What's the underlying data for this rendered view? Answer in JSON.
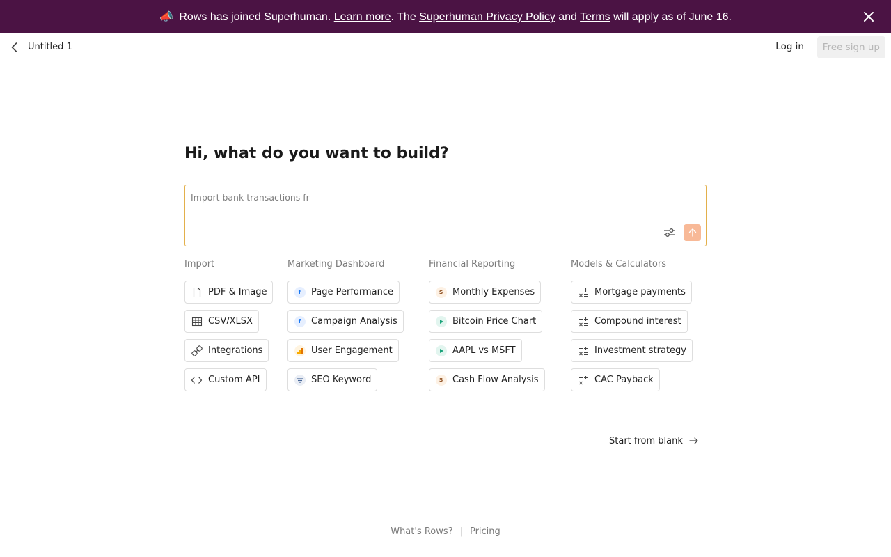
{
  "banner": {
    "megaphone": "📣",
    "text_1": " Rows has joined Superhuman. ",
    "learn_more": "Learn more",
    "text_2": ". The ",
    "privacy_policy": "Superhuman Privacy Policy",
    "text_3": " and ",
    "terms": "Terms",
    "text_4": " will apply as of June 16.",
    "close_icon": "close-icon",
    "background": "#4b1344"
  },
  "topbar": {
    "back_icon": "chevron-left-icon",
    "title": "Untitled 1",
    "login": "Log in",
    "signup": "Free sign up"
  },
  "main": {
    "headline": "Hi, what do you want to build?",
    "prompt": {
      "value": "",
      "placeholder": "Import bank transactions fr",
      "settings_icon": "sliders-icon",
      "submit_icon": "arrow-up-icon",
      "accent": "#e3b04b",
      "submit_color": "#f8b997"
    },
    "columns": [
      {
        "header": "Import",
        "items": [
          {
            "label": "PDF & Image",
            "icon": "file-icon"
          },
          {
            "label": "CSV/XLSX",
            "icon": "table-icon"
          },
          {
            "label": "Integrations",
            "icon": "link-icon"
          },
          {
            "label": "Custom API",
            "icon": "code-icon"
          }
        ]
      },
      {
        "header": "Marketing Dashboard",
        "items": [
          {
            "label": "Page Performance",
            "icon": "facebook-icon"
          },
          {
            "label": "Campaign Analysis",
            "icon": "facebook-icon"
          },
          {
            "label": "User Engagement",
            "icon": "analytics-icon"
          },
          {
            "label": "SEO Keyword",
            "icon": "search-console-icon"
          }
        ]
      },
      {
        "header": "Financial Reporting",
        "items": [
          {
            "label": "Monthly Expenses",
            "icon": "dollar-icon"
          },
          {
            "label": "Bitcoin Price Chart",
            "icon": "play-icon"
          },
          {
            "label": "AAPL vs MSFT",
            "icon": "play-icon"
          },
          {
            "label": "Cash Flow Analysis",
            "icon": "dollar-icon"
          }
        ]
      },
      {
        "header": "Models & Calculators",
        "items": [
          {
            "label": "Mortgage payments",
            "icon": "calculator-icon"
          },
          {
            "label": "Compound interest",
            "icon": "calculator-icon"
          },
          {
            "label": "Investment strategy",
            "icon": "calculator-icon"
          },
          {
            "label": "CAC Payback",
            "icon": "calculator-icon"
          }
        ]
      }
    ],
    "start_blank": "Start from blank"
  },
  "footer": {
    "whats_rows": "What's Rows?",
    "separator": "|",
    "pricing": "Pricing"
  }
}
